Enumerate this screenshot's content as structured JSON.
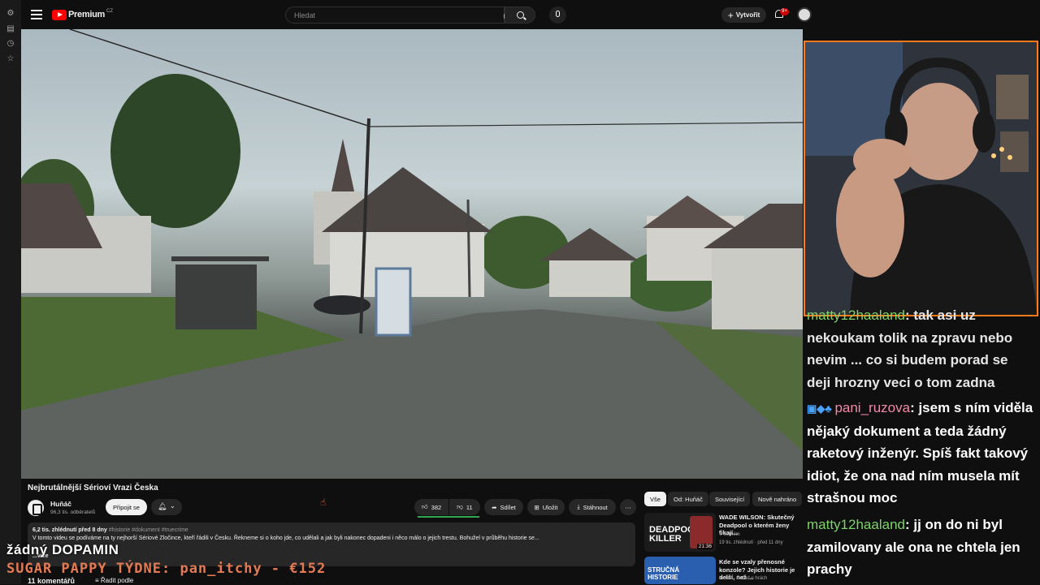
{
  "header": {
    "brand": "Premium",
    "brand_region": "CZ",
    "search_placeholder": "Hledat",
    "create_label": "Vytvořit",
    "notifications_badge": "9+"
  },
  "video": {
    "title": "Nejbrutálnější Sérioví Vrazi Česka",
    "channel": "Huňáč",
    "subscribers": "96,3 tis. odběratelů",
    "join_label": "Připojit se",
    "likes": "382",
    "dislikes": "11",
    "share_label": "Sdílet",
    "save_label": "Uložit",
    "download_label": "Stáhnout",
    "views_date": "6,2 tis. zhlédnutí  před 8 dny",
    "hashtags": "#historie #dokument #truecrime",
    "description": "V tomto videu se podíváme na ty nejhorší Sériové Zločince, kteří řádili v Česku. Řekneme si o koho jde, co udělali a jak byli nakonec dopadeni i něco málo o jejich trestu. Bohužel v průběhu historie se...",
    "more": "...více",
    "comments_count": "11 komentářů",
    "sort_label": "Řadit podle"
  },
  "chips": [
    "Vše",
    "Od: Huňáč",
    "Související",
    "Nově nahráno"
  ],
  "recommendations": [
    {
      "title": "WADE WILSON: Skutečný Deadpool o kterém ženy fikají...",
      "channel": "V černém",
      "meta": "19 tis. zhlédnutí · před 11 dny",
      "duration": "21:36",
      "thumb_text": "DEADPOOL KILLER"
    },
    {
      "title": "Kde se vzaly přenosné konzole? Jejich historie je delší, než ...",
      "channel": "",
      "meta": "Indian · Pořad o hrách",
      "duration": "",
      "thumb_text": "STRUČNÁ HISTORIE"
    }
  ],
  "overlay": {
    "line1": "žádný DOPAMIN",
    "line2": "SUGAR PAPPY TÝDNE: pan_itchy - €152"
  },
  "chat": [
    {
      "user": "matty12haaland",
      "text": ": tak asi uz nekoukam tolik na zpravu nebo nevim ... co si budem porad se deji hrozny veci o tom zadna",
      "color": "#7ed36b"
    },
    {
      "user": "pani_ruzova",
      "text": ": jsem s ním viděla nějaký dokument a teda žádný raketový inženýr. Spíš fakt takový idiot, že ona nad ním musela mít strašnou moc",
      "color": "#f08aa8"
    },
    {
      "user": "matty12haaland",
      "text": ": jj on do ni byl zamilovany ale ona ne chtela jen prachy",
      "color": "#7ed36b"
    }
  ]
}
